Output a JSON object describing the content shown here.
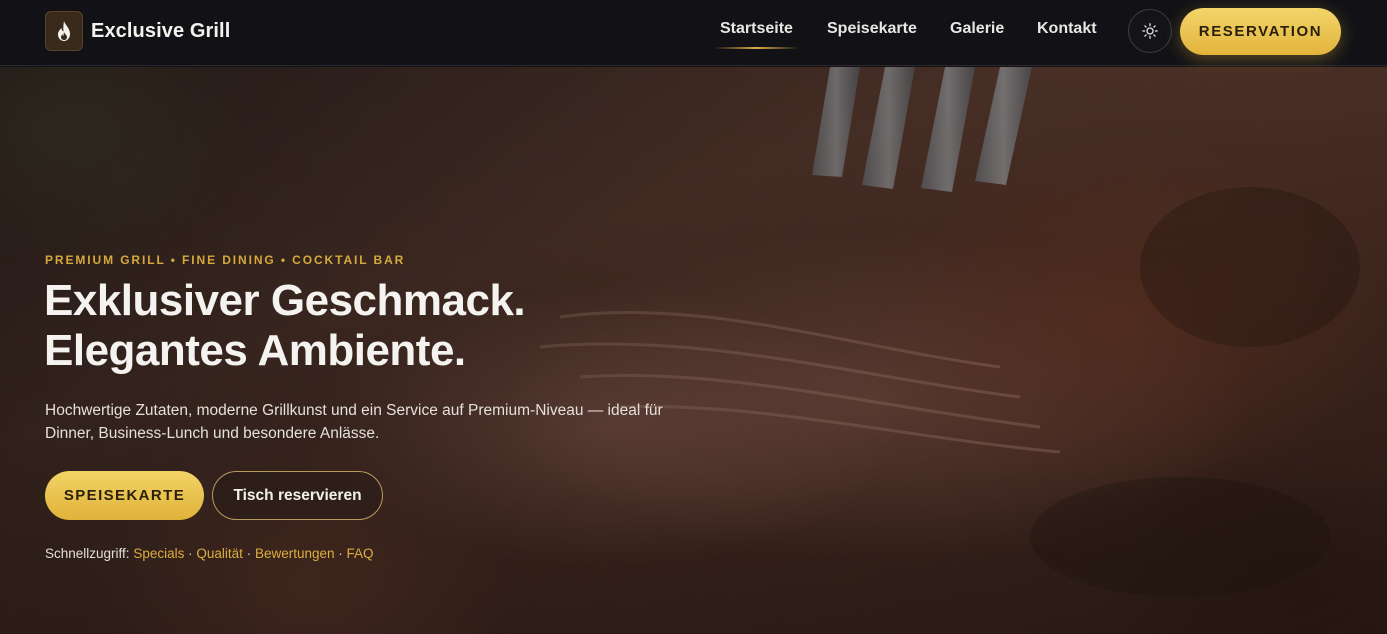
{
  "brand": {
    "name": "Exclusive Grill",
    "logo_icon": "flame-icon"
  },
  "nav": {
    "items": [
      {
        "label": "Startseite",
        "active": true
      },
      {
        "label": "Speisekarte",
        "active": false
      },
      {
        "label": "Galerie",
        "active": false
      },
      {
        "label": "Kontakt",
        "active": false
      }
    ],
    "theme_toggle_icon": "sun-icon",
    "reserve_label": "RESERVATION"
  },
  "hero": {
    "kicker": "PREMIUM GRILL • FINE DINING • COCKTAIL BAR",
    "headline_line1": "Exklusiver Geschmack.",
    "headline_line2": "Elegantes Ambiente.",
    "lead": "Hochwertige Zutaten, moderne Grillkunst und ein Service auf Premium-Niveau — ideal für Dinner, Business-Lunch und besondere Anlässe.",
    "primary_button": "SPEISEKARTE",
    "secondary_button": "Tisch reservieren",
    "quick_access": {
      "label": "Schnellzugriff:",
      "links": [
        "Specials",
        "Qualität",
        "Bewertungen",
        "FAQ"
      ]
    }
  },
  "colors": {
    "accent": "#e2b43c",
    "nav_bg": "#121216",
    "kicker": "#d6a93c"
  }
}
